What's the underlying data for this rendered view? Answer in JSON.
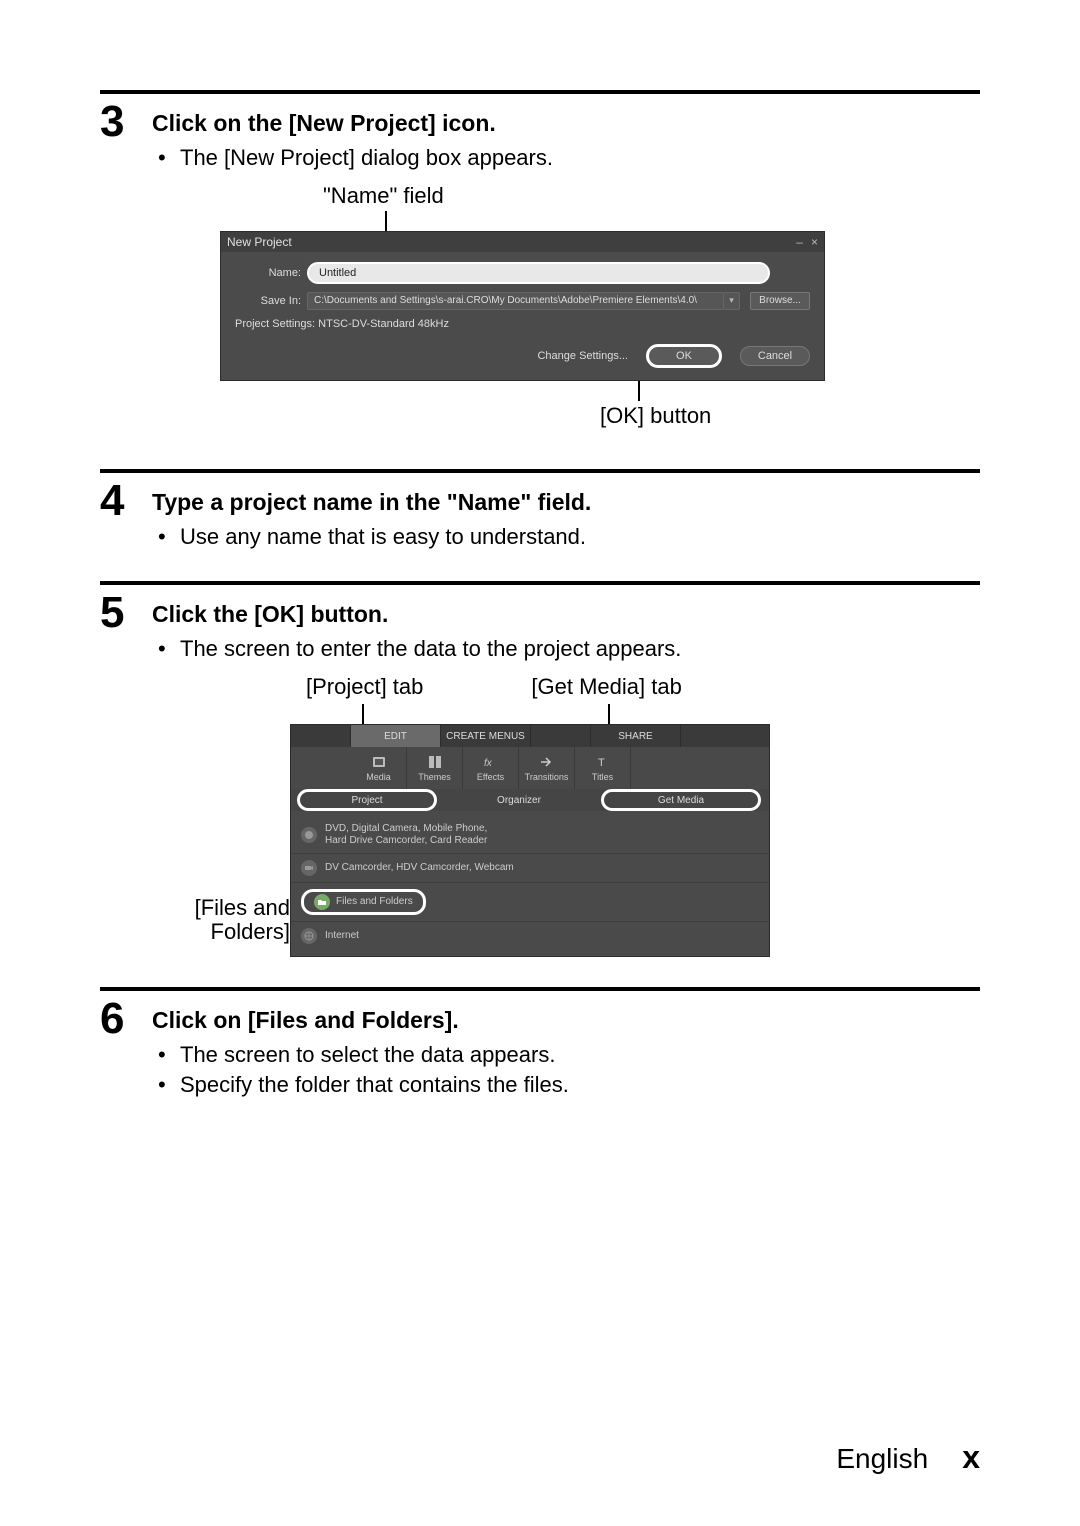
{
  "steps": {
    "s3": {
      "num": "3",
      "heading": "Click on the [New Project] icon.",
      "bullet1": "The [New Project] dialog box appears.",
      "annot_name": "\"Name\" field",
      "annot_ok": "[OK] button"
    },
    "s4": {
      "num": "4",
      "heading": "Type a project name in the \"Name\" field.",
      "bullet1": "Use any name that is easy to understand."
    },
    "s5": {
      "num": "5",
      "heading": "Click the [OK] button.",
      "bullet1": "The screen to enter the data to the project appears.",
      "annot_project": "[Project] tab",
      "annot_getmedia": "[Get Media] tab",
      "annot_files": "[Files and Folders]"
    },
    "s6": {
      "num": "6",
      "heading": "Click on [Files and Folders].",
      "bullet1": "The screen to select the data appears.",
      "bullet2": "Specify the folder that contains the files."
    }
  },
  "dialog": {
    "title": "New Project",
    "name_label": "Name:",
    "name_value": "Untitled",
    "savein_label": "Save In:",
    "savein_value": "C:\\Documents and Settings\\s-arai.CRO\\My Documents\\Adobe\\Premiere Elements\\4.0\\",
    "browse": "Browse...",
    "proj_settings": "Project Settings:  NTSC-DV-Standard 48kHz",
    "change_settings": "Change Settings...",
    "ok": "OK",
    "cancel": "Cancel"
  },
  "editor": {
    "tabs": {
      "edit": "EDIT",
      "create_menus": "CREATE MENUS",
      "share": "SHARE"
    },
    "tools": {
      "media": "Media",
      "themes": "Themes",
      "effects": "Effects",
      "transitions": "Transitions",
      "titles": "Titles"
    },
    "subtabs": {
      "project": "Project",
      "organizer": "Organizer",
      "get_media": "Get Media"
    },
    "sources": {
      "dvd": "DVD, Digital Camera, Mobile Phone,\nHard Drive Camcorder, Card Reader",
      "camcorder": "DV Camcorder, HDV Camcorder, Webcam",
      "files_folders": "Files and Folders",
      "internet": "Internet"
    }
  },
  "footer": {
    "language": "English",
    "page": "x"
  }
}
